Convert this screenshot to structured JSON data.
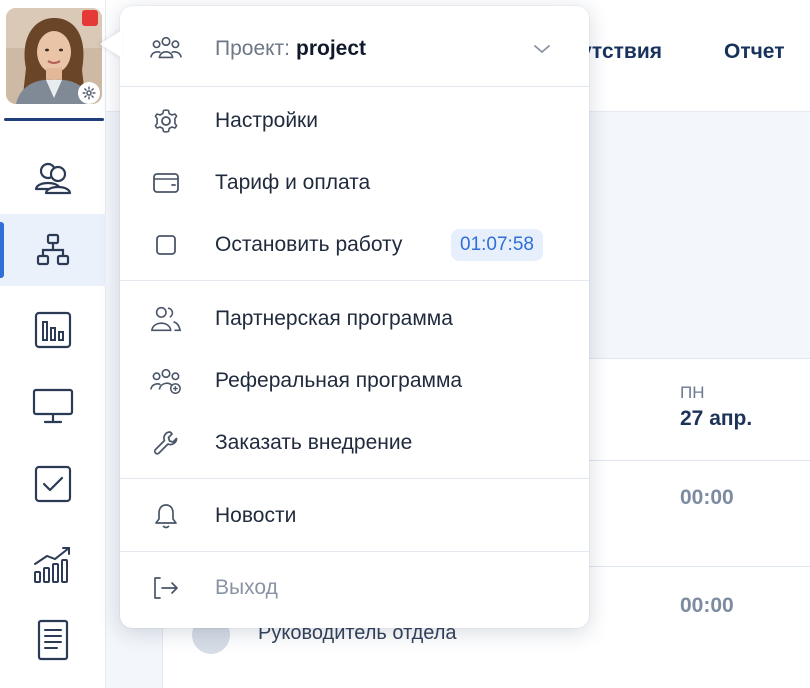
{
  "background": {
    "tabs": [
      "утствия",
      "Отчет"
    ],
    "table": {
      "day_name": "ПН",
      "date": "27 апр.",
      "times": [
        "00:00",
        "00:00"
      ],
      "role": "Руководитель отдела"
    }
  },
  "menu": {
    "project": {
      "prefix": "Проект:",
      "name": "project"
    },
    "items": {
      "settings": "Настройки",
      "billing": "Тариф и оплата",
      "stop_work": "Остановить работу",
      "timer": "01:07:58",
      "partner": "Партнерская программа",
      "referral": "Реферальная программа",
      "order_implementation": "Заказать внедрение",
      "news": "Новости",
      "logout": "Выход"
    }
  },
  "sidebar": {
    "icons": [
      "users-icon",
      "org-structure-icon",
      "bar-chart-icon",
      "monitor-icon",
      "checkbox-icon",
      "growth-chart-icon",
      "document-icon"
    ],
    "active_index": 1
  },
  "colors": {
    "accent": "#2f6fd6",
    "navy": "#18325e",
    "notification": "#e53935",
    "timer_bg": "#e6effb"
  }
}
